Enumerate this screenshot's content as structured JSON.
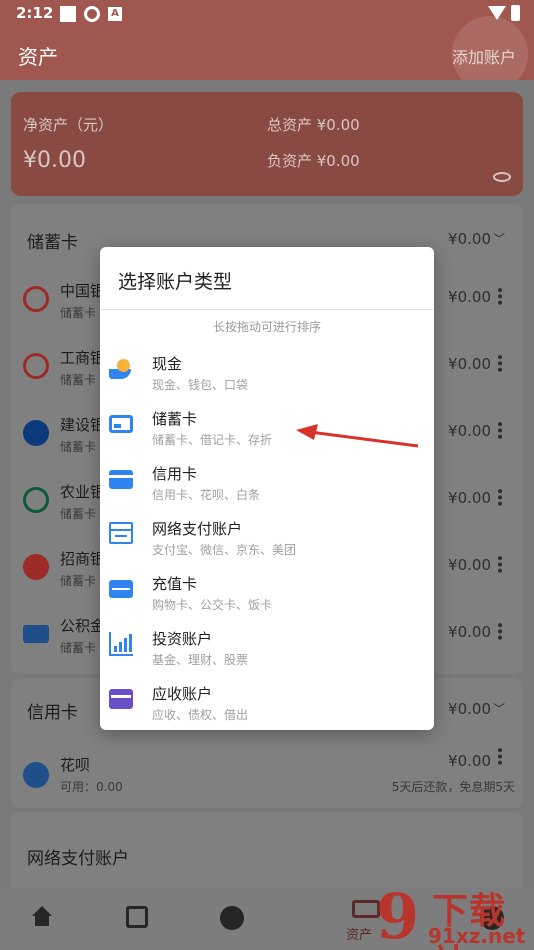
{
  "status_bar": {
    "time": "2:12",
    "notif_letter": "A"
  },
  "app_bar": {
    "title": "资产",
    "add_account": "添加账户"
  },
  "summary": {
    "net_label": "净资产（元）",
    "net_value": "¥0.00",
    "total_assets": "总资产 ¥0.00",
    "total_debt": "负资产 ¥0.00"
  },
  "savings_section": {
    "title": "储蓄卡",
    "amount": "¥0.00",
    "rows": [
      {
        "name": "中国银",
        "sub": "储蓄卡",
        "amount": "¥0.00",
        "icon": "boc-logo-icon",
        "color": "#9c2a26"
      },
      {
        "name": "工商银",
        "sub": "储蓄卡",
        "amount": "¥0.00",
        "icon": "icbc-logo-icon",
        "color": "#9c2a26"
      },
      {
        "name": "建设银",
        "sub": "储蓄卡",
        "amount": "¥0.00",
        "icon": "ccb-logo-icon",
        "color": "#0d3a7a"
      },
      {
        "name": "农业银",
        "sub": "储蓄卡",
        "amount": "¥0.00",
        "icon": "abc-logo-icon",
        "color": "#0d5a3a"
      },
      {
        "name": "招商银",
        "sub": "储蓄卡",
        "amount": "¥0.00",
        "icon": "cmb-logo-icon",
        "color": "#9c2a26"
      },
      {
        "name": "公积金",
        "sub": "储蓄卡",
        "amount": "¥0.00",
        "icon": "card-icon",
        "color": "#1f4f8a"
      }
    ]
  },
  "credit_section": {
    "title": "信用卡",
    "amount": "¥0.00",
    "row": {
      "name": "花呗",
      "available": "可用：0.00",
      "amount": "¥0.00",
      "note": "5天后还款，免息期5天"
    }
  },
  "network_section": {
    "title": "网络支付账户"
  },
  "dialog": {
    "title": "选择账户类型",
    "hint": "长按拖动可进行排序",
    "options": [
      {
        "name": "现金",
        "sub": "现金、钱包、口袋",
        "icon": "cash-hand-icon"
      },
      {
        "name": "储蓄卡",
        "sub": "储蓄卡、借记卡、存折",
        "icon": "debit-card-icon"
      },
      {
        "name": "信用卡",
        "sub": "信用卡、花呗、白条",
        "icon": "credit-card-icon"
      },
      {
        "name": "网络支付账户",
        "sub": "支付宝、微信、京东、美团",
        "icon": "online-payment-icon"
      },
      {
        "name": "充值卡",
        "sub": "购物卡、公交卡、饭卡",
        "icon": "prepaid-card-icon"
      },
      {
        "name": "投资账户",
        "sub": "基金、理财、股票",
        "icon": "investment-chart-icon"
      },
      {
        "name": "应收账户",
        "sub": "应收、债权、借出",
        "icon": "receivable-card-icon"
      }
    ]
  },
  "bottom_nav": {
    "assets_label": "资产"
  },
  "watermark": {
    "brand": "下载站",
    "domain": "91xz.net",
    "digit": "9"
  },
  "colors": {
    "primary": "#a0574f",
    "accent_blue": "#2f84f1",
    "annotation_red": "#d9322b"
  }
}
